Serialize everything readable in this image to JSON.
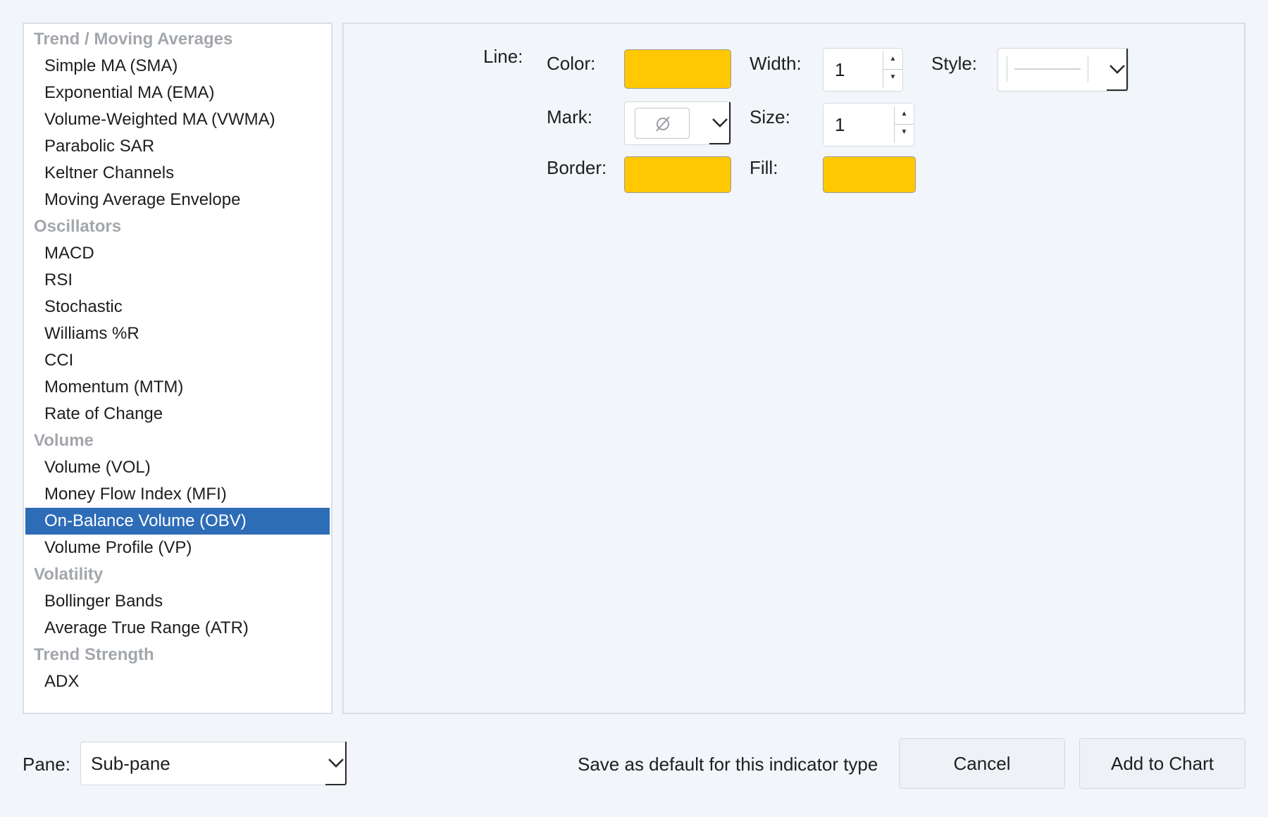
{
  "list": {
    "rows": [
      {
        "kind": "group",
        "label": "Trend / Moving Averages"
      },
      {
        "kind": "item",
        "label": "Simple MA (SMA)"
      },
      {
        "kind": "item",
        "label": "Exponential MA (EMA)"
      },
      {
        "kind": "item",
        "label": "Volume-Weighted MA (VWMA)"
      },
      {
        "kind": "item",
        "label": "Parabolic SAR"
      },
      {
        "kind": "item",
        "label": "Keltner Channels"
      },
      {
        "kind": "item",
        "label": "Moving Average Envelope"
      },
      {
        "kind": "group",
        "label": "Oscillators"
      },
      {
        "kind": "item",
        "label": "MACD"
      },
      {
        "kind": "item",
        "label": "RSI"
      },
      {
        "kind": "item",
        "label": "Stochastic"
      },
      {
        "kind": "item",
        "label": "Williams %R"
      },
      {
        "kind": "item",
        "label": "CCI"
      },
      {
        "kind": "item",
        "label": "Momentum (MTM)"
      },
      {
        "kind": "item",
        "label": "Rate of Change"
      },
      {
        "kind": "group",
        "label": "Volume"
      },
      {
        "kind": "item",
        "label": "Volume (VOL)"
      },
      {
        "kind": "item",
        "label": "Money Flow Index (MFI)"
      },
      {
        "kind": "item",
        "label": "On-Balance Volume (OBV)",
        "selected": true
      },
      {
        "kind": "item",
        "label": "Volume Profile (VP)"
      },
      {
        "kind": "group",
        "label": "Volatility"
      },
      {
        "kind": "item",
        "label": "Bollinger Bands"
      },
      {
        "kind": "item",
        "label": "Average True Range (ATR)"
      },
      {
        "kind": "group",
        "label": "Trend Strength"
      },
      {
        "kind": "item",
        "label": "ADX"
      }
    ]
  },
  "options": {
    "line_label": "Line:",
    "color_label": "Color:",
    "color_value": "#ffc800",
    "width_label": "Width:",
    "width_value": "1",
    "style_label": "Style:",
    "mark_label": "Mark:",
    "mark_icon": "no-marker-icon",
    "size_label": "Size:",
    "size_value": "1",
    "border_label": "Border:",
    "border_color": "#ffc800",
    "fill_label": "Fill:",
    "fill_color": "#ffc800"
  },
  "footer": {
    "pane_label": "Pane:",
    "pane_value": "Sub-pane",
    "save_default_label": "Save as default for this indicator type",
    "cancel_label": "Cancel",
    "add_label": "Add to Chart"
  },
  "colors": {
    "selection": "#2d6cb7",
    "group_text": "#a3a7ac",
    "background": "#f2f5f9"
  }
}
